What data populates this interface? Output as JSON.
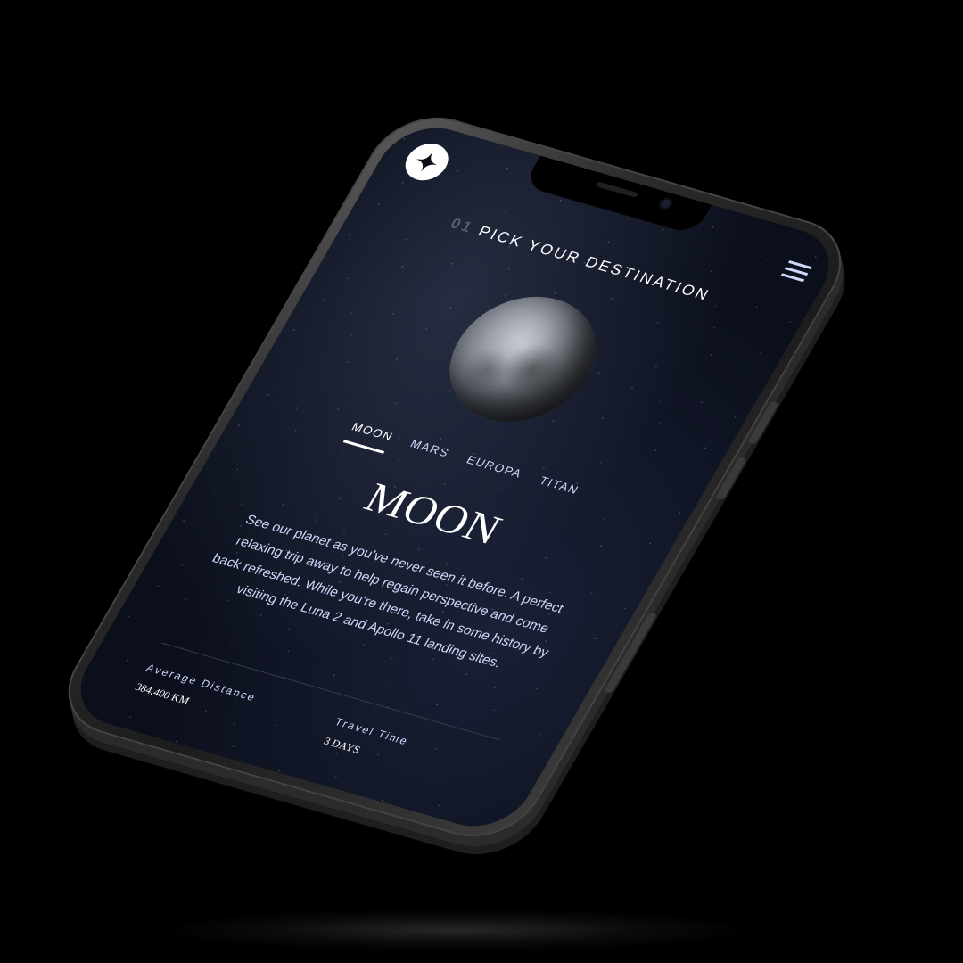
{
  "header": {
    "menu_icon": "hamburger-menu-icon",
    "logo_icon": "star-logo-icon"
  },
  "page_heading": {
    "number": "01",
    "title": "PICK YOUR DESTINATION"
  },
  "tabs": [
    {
      "label": "MOON",
      "active": true
    },
    {
      "label": "MARS",
      "active": false
    },
    {
      "label": "EUROPA",
      "active": false
    },
    {
      "label": "TITAN",
      "active": false
    }
  ],
  "destination": {
    "name": "MOON",
    "description": "See our planet as you’ve never seen it before. A perfect relaxing trip away to help regain perspective and come back refreshed. While you’re there, take in some history by visiting the Luna 2 and Apollo 11 landing sites."
  },
  "stats": {
    "distance_label": "Average Distance",
    "distance_value": "384,400 KM",
    "travel_label": "Travel Time",
    "travel_value": "3 DAYS"
  },
  "colors": {
    "background": "#0b0f1c",
    "accent_text": "#d0d6f9",
    "primary_text": "#ffffff",
    "divider": "#383b4b"
  }
}
